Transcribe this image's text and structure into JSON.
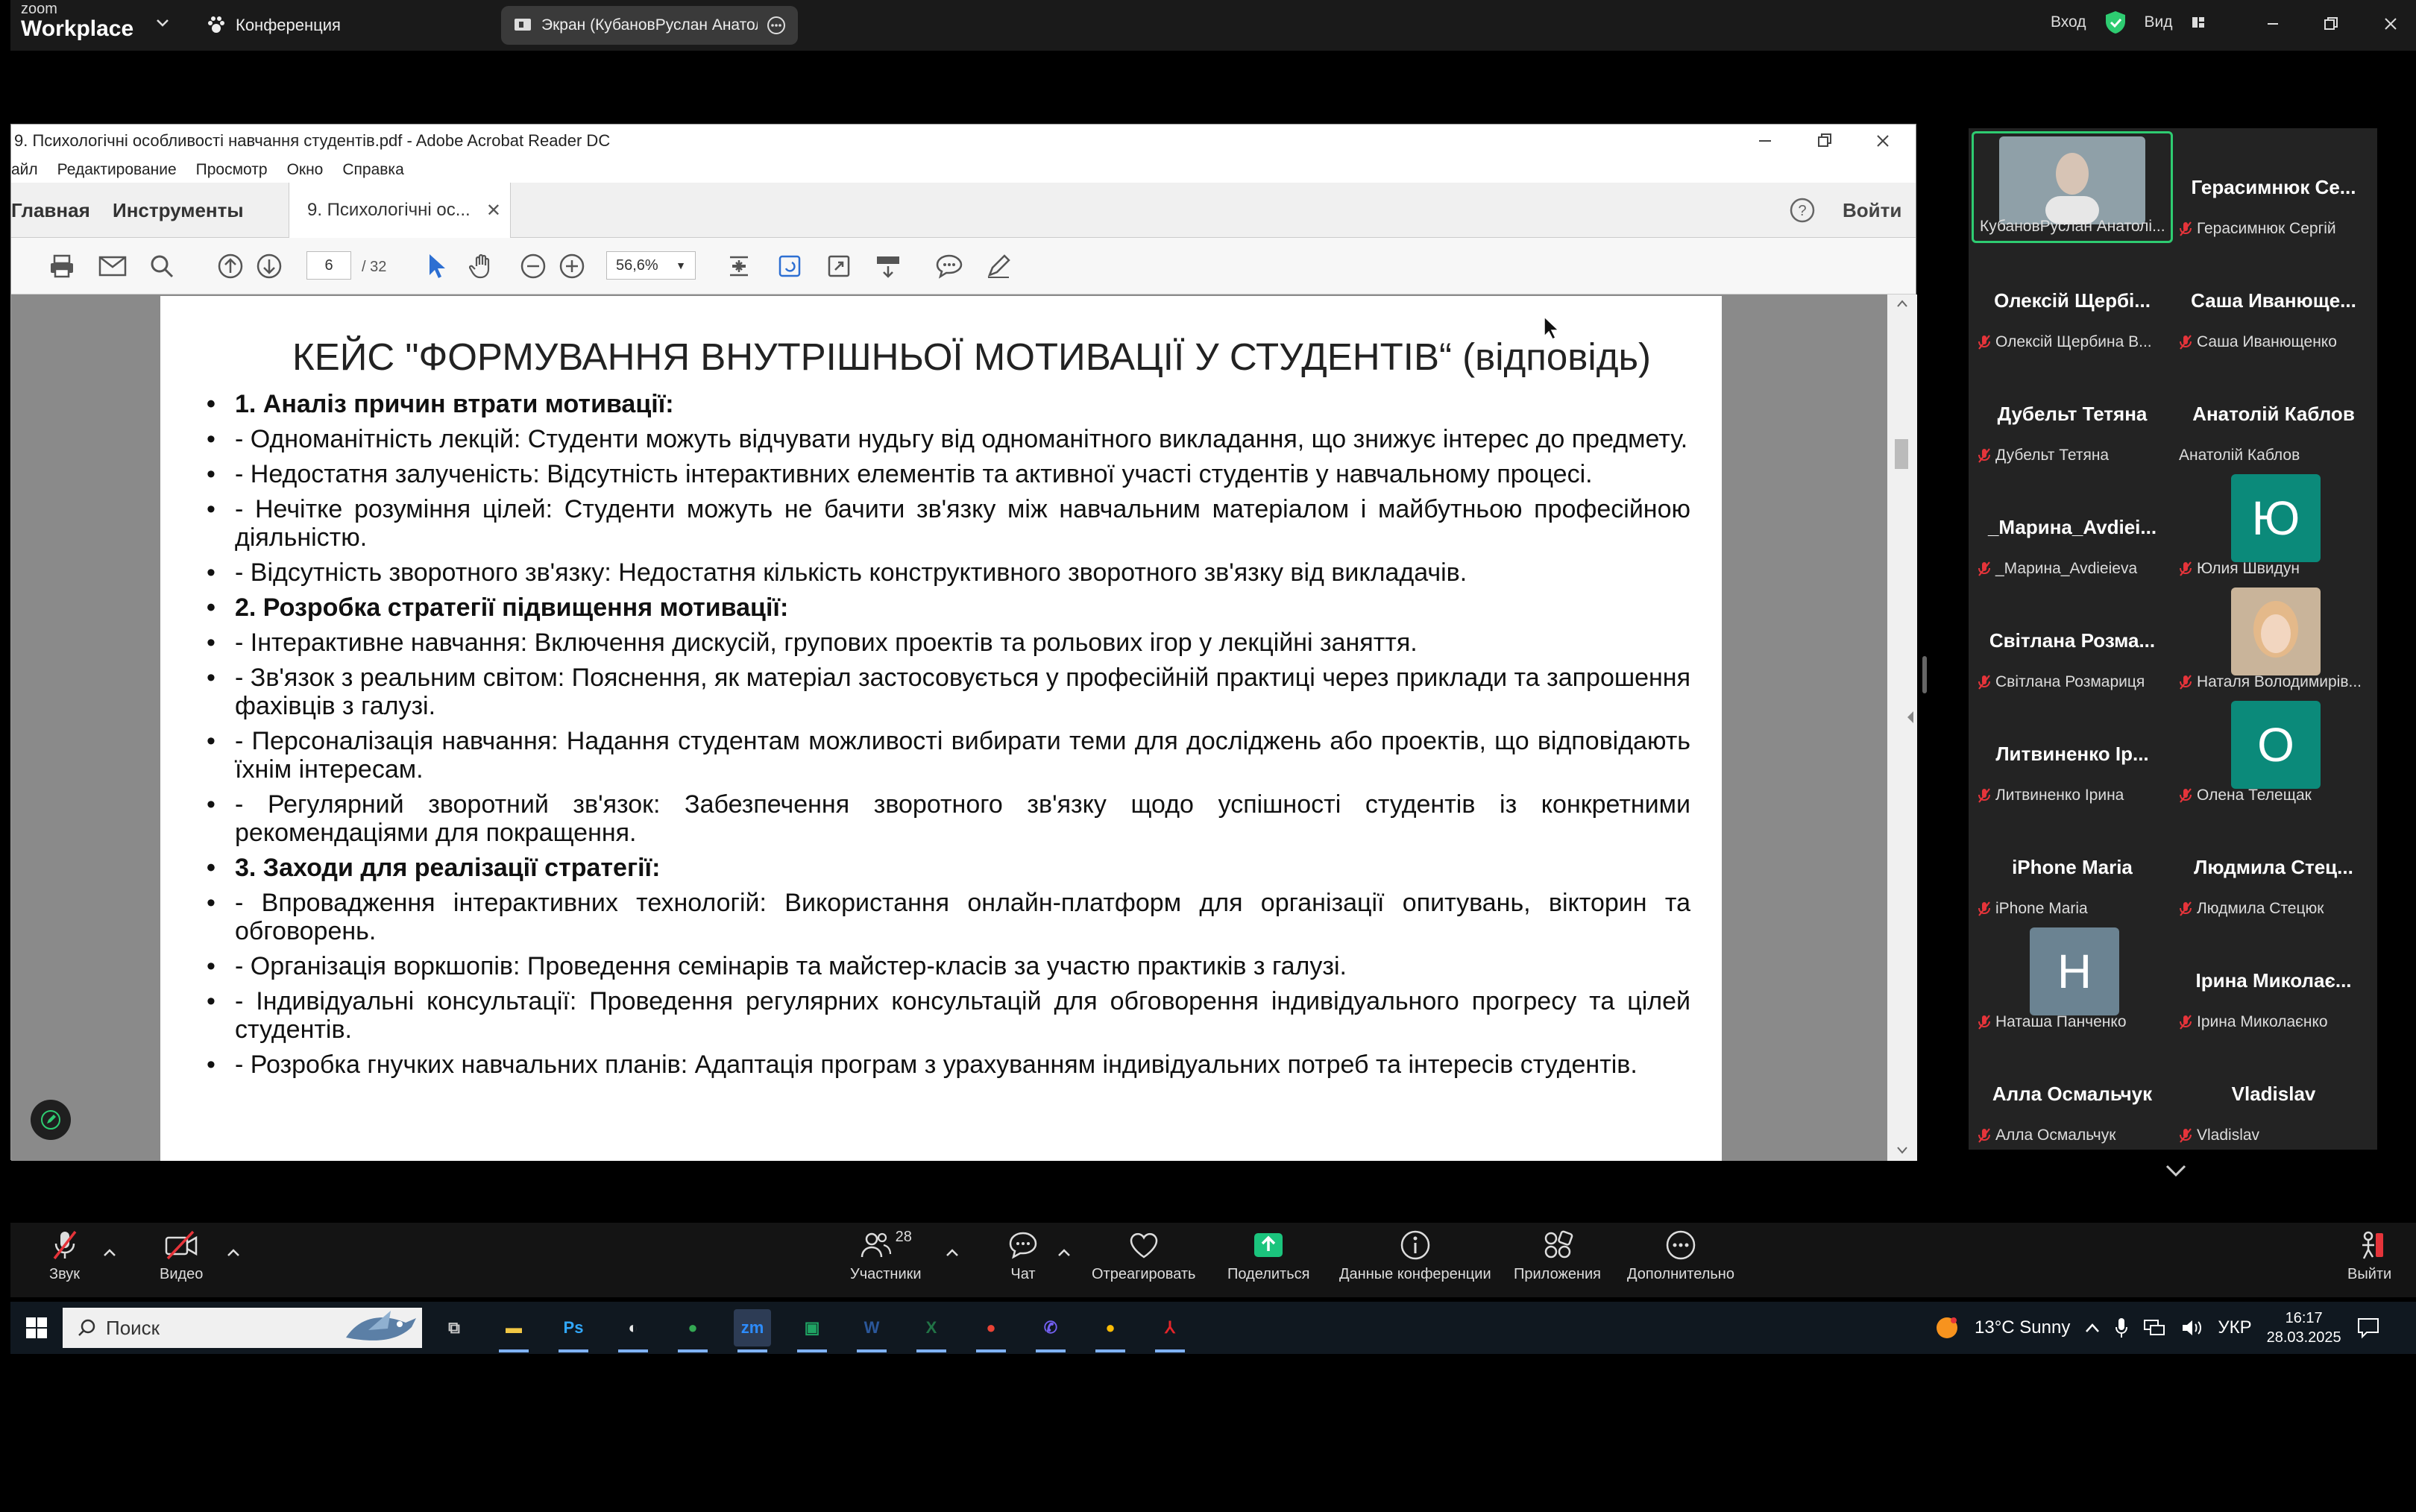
{
  "zoom": {
    "logo_small": "zoom",
    "logo_big": "Workplace",
    "conference_label": "Конференция",
    "share_label": "Экран (КубановРуслан Анатолі",
    "signin_label": "Вход",
    "view_label": "Вид",
    "accent_green": "#2ecc71"
  },
  "acrobat": {
    "window_title": "9. Психологічні особливості навчання студентів.pdf - Adobe Acrobat Reader DC",
    "menu": [
      "айл",
      "Редактирование",
      "Просмотр",
      "Окно",
      "Справка"
    ],
    "tab_home": "Главная",
    "tab_tools": "Инструменты",
    "tab_doc": "9. Психологічні ос...",
    "signin": "Войти",
    "page_current": "6",
    "page_total": "/ 32",
    "zoom_value": "56,6%"
  },
  "doc": {
    "title": "КЕЙС \"ФОРМУВАННЯ ВНУТРІШНЬОЇ МОТИВАЦІЇ У СТУДЕНТІВ“ (відповідь)",
    "items": [
      {
        "text": "1. Аналіз причин втрати мотивації:",
        "heading": true
      },
      {
        "text": "- Одноманітність лекцій: Студенти можуть відчувати нудьгу від одноманітного викладання, що знижує інтерес до предмету.",
        "heading": false
      },
      {
        "text": "- Недостатня залученість: Відсутність інтерактивних елементів та активної участі студентів у навчальному процесі.",
        "heading": false
      },
      {
        "text": "- Нечітке розуміння цілей: Студенти можуть не бачити зв'язку між навчальним матеріалом і майбутньою професійною діяльністю.",
        "heading": false
      },
      {
        "text": "- Відсутність зворотного зв'язку: Недостатня кількість конструктивного зворотного зв'язку від викладачів.",
        "heading": false
      },
      {
        "text": "2. Розробка стратегії підвищення мотивації:",
        "heading": true
      },
      {
        "text": "- Інтерактивне навчання: Включення дискусій, групових проектів та рольових ігор у лекційні заняття.",
        "heading": false
      },
      {
        "text": "- Зв'язок з реальним світом: Пояснення, як матеріал застосовується у професійній практиці через приклади та запрошення фахівців з галузі.",
        "heading": false
      },
      {
        "text": "- Персоналізація навчання: Надання студентам можливості вибирати теми для досліджень або проектів, що відповідають їхнім інтересам.",
        "heading": false
      },
      {
        "text": "- Регулярний зворотний зв'язок: Забезпечення зворотного зв'язку щодо успішності студентів із конкретними рекомендаціями для покращення.",
        "heading": false
      },
      {
        "text": "3. Заходи для реалізації стратегії:",
        "heading": true
      },
      {
        "text": "- Впровадження інтерактивних технологій: Використання онлайн-платформ для організації опитувань, вікторин та обговорень.",
        "heading": false
      },
      {
        "text": "- Організація воркшопів: Проведення семінарів та майстер-класів за участю практиків з галузі.",
        "heading": false
      },
      {
        "text": "- Індивідуальні консультації: Проведення регулярних консультацій для обговорення індивідуального прогресу та цілей студентів.",
        "heading": false
      },
      {
        "text": "- Розробка гнучких навчальних планів: Адаптація програм з урахуванням індивідуальних потреб та інтересів студентів.",
        "heading": false
      }
    ]
  },
  "participants": [
    {
      "name": "",
      "label": "КубановРуслан Анатолі...",
      "avatar": "photo",
      "muted": false
    },
    {
      "name": "Герасимнюк Се...",
      "label": "Герасимнюк Сергій",
      "avatar": "",
      "muted": true
    },
    {
      "name": "Олексій Щербі...",
      "label": "Олексій Щербина В...",
      "avatar": "",
      "muted": true
    },
    {
      "name": "Саша Иванюще...",
      "label": "Саша Иванющенко",
      "avatar": "",
      "muted": true
    },
    {
      "name": "Дубельт Тетяна",
      "label": "Дубельт Тетяна",
      "avatar": "",
      "muted": true
    },
    {
      "name": "Анатолій Каблов",
      "label": "Анатолій Каблов",
      "avatar": "",
      "muted": false
    },
    {
      "name": "_Марина_Avdiei...",
      "label": "_Марина_Avdieieva",
      "avatar": "",
      "muted": true
    },
    {
      "name": "",
      "label": "Юлия Швидун",
      "avatar": "Ю",
      "avatar_color": "#0b8a7a",
      "muted": true
    },
    {
      "name": "Світлана Розма...",
      "label": "Світлана Розмариця",
      "avatar": "",
      "muted": true
    },
    {
      "name": "",
      "label": "Наталя Володимирів...",
      "avatar": "photo2",
      "muted": true
    },
    {
      "name": "Литвиненко Ір...",
      "label": "Литвиненко Ірина",
      "avatar": "",
      "muted": true
    },
    {
      "name": "",
      "label": "Олена Телещак",
      "avatar": "О",
      "avatar_color": "#0b8a7a",
      "muted": true
    },
    {
      "name": "iPhone Maria",
      "label": "iPhone Maria",
      "avatar": "",
      "muted": true
    },
    {
      "name": "Людмила Стец...",
      "label": "Людмила Стецюк",
      "avatar": "",
      "muted": true
    },
    {
      "name": "",
      "label": "Наташа Панченко",
      "avatar": "Н",
      "avatar_color": "#6b8392",
      "muted": true
    },
    {
      "name": "Ірина Миколає...",
      "label": "Ірина Миколаєнко",
      "avatar": "",
      "muted": true
    },
    {
      "name": "Алла Осмальчук",
      "label": "Алла Осмальчук",
      "avatar": "",
      "muted": true
    },
    {
      "name": "Vladislav",
      "label": "Vladislav",
      "avatar": "",
      "muted": true
    }
  ],
  "controls": {
    "audio": "Звук",
    "video": "Видео",
    "participants": "Участники",
    "participants_count": "28",
    "chat": "Чат",
    "react": "Отреагировать",
    "share": "Поделиться",
    "info": "Данные конференции",
    "apps": "Приложения",
    "more": "Дополнительно",
    "leave": "Выйти"
  },
  "taskbar": {
    "search": "Поиск",
    "weather": "13°C  Sunny",
    "lang": "УКР",
    "time": "16:17",
    "date": "28.03.2025",
    "apps": [
      {
        "id": "taskview",
        "glyph": "⧉",
        "color": "#ccc"
      },
      {
        "id": "explorer",
        "glyph": "▬",
        "color": "#f2c744"
      },
      {
        "id": "photoshop",
        "glyph": "Ps",
        "color": "#31a8ff"
      },
      {
        "id": "paint",
        "glyph": "◐",
        "color": "#e8e8e8"
      },
      {
        "id": "chrome",
        "glyph": "●",
        "color": "#34a853"
      },
      {
        "id": "zoom",
        "glyph": "zm",
        "color": "#2d8cff"
      },
      {
        "id": "hangouts",
        "glyph": "▣",
        "color": "#1fa463"
      },
      {
        "id": "word",
        "glyph": "W",
        "color": "#2b579a"
      },
      {
        "id": "excel",
        "glyph": "X",
        "color": "#217346"
      },
      {
        "id": "chrome2",
        "glyph": "●",
        "color": "#ea4335"
      },
      {
        "id": "viber",
        "glyph": "✆",
        "color": "#7360f2"
      },
      {
        "id": "chrome3",
        "glyph": "●",
        "color": "#fbbc05"
      },
      {
        "id": "acrobat",
        "glyph": "⅄",
        "color": "#e5252a"
      }
    ]
  }
}
